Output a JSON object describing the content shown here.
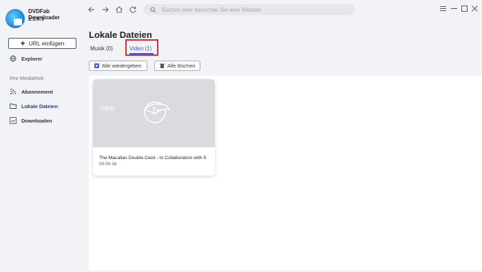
{
  "app": {
    "name": "DVDFab Downloader",
    "version": "2.3.0.3"
  },
  "sidebar": {
    "url_button_label": "URL einfügen",
    "explorer_label": "Explorer",
    "section_label": "Ihre Mediathek",
    "items": [
      {
        "label": "Abonnement",
        "icon": "rss-icon"
      },
      {
        "label": "Lokale Dateien",
        "icon": "folder-icon"
      },
      {
        "label": "Downloaden",
        "icon": "download-icon"
      }
    ]
  },
  "topbar": {
    "search_placeholder": "Suchen oder besuchen Sie eine Website"
  },
  "main": {
    "title": "Lokale Dateien",
    "tabs": [
      {
        "label": "Musik (0)"
      },
      {
        "label": "Video (1)"
      }
    ],
    "actions": {
      "play_all": "Alle wiedergeben",
      "delete_all": "Alle löschen"
    }
  },
  "video_card": {
    "resolution": "1080p",
    "title": "The Macallan Double Cask - In Collaboration with S",
    "duration": "00:00:16"
  },
  "colors": {
    "accent": "#4a5cd8",
    "highlight_box": "#d32f2f",
    "active_nav": "#2e3a8c"
  }
}
